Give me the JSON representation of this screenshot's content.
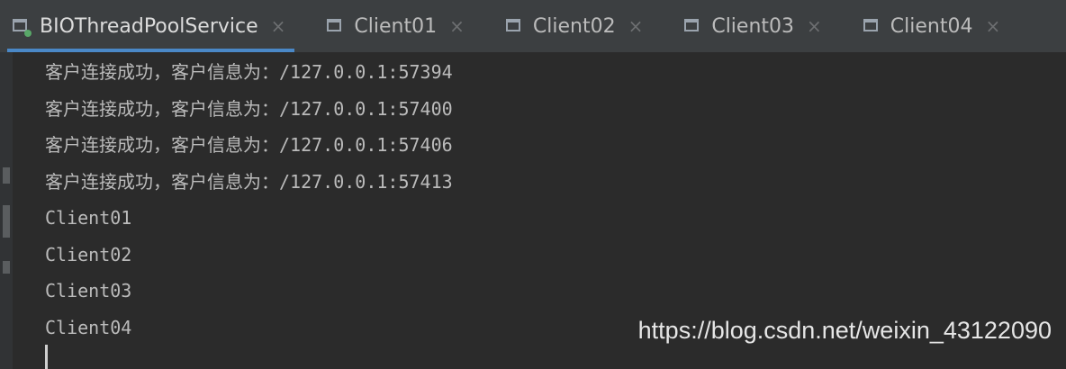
{
  "tabs": [
    {
      "label": "BIOThreadPoolService",
      "active": true
    },
    {
      "label": "Client01",
      "active": false
    },
    {
      "label": "Client02",
      "active": false
    },
    {
      "label": "Client03",
      "active": false
    },
    {
      "label": "Client04",
      "active": false
    }
  ],
  "tab_close_glyph": "×",
  "console": {
    "lines": [
      "客户连接成功，客户信息为：/127.0.0.1:57394",
      "客户连接成功，客户信息为：/127.0.0.1:57400",
      "客户连接成功，客户信息为：/127.0.0.1:57406",
      "客户连接成功，客户信息为：/127.0.0.1:57413",
      "Client01",
      "Client02",
      "Client03",
      "Client04"
    ]
  },
  "watermark": "https://blog.csdn.net/weixin_43122090",
  "colors": {
    "background": "#2b2b2b",
    "tabbar": "#3c3f41",
    "active_tab_underline": "#4a88c7",
    "text": "#bbbbbb"
  },
  "icons": {
    "run_tab": "run-console-icon",
    "console_tab": "console-window-icon"
  }
}
